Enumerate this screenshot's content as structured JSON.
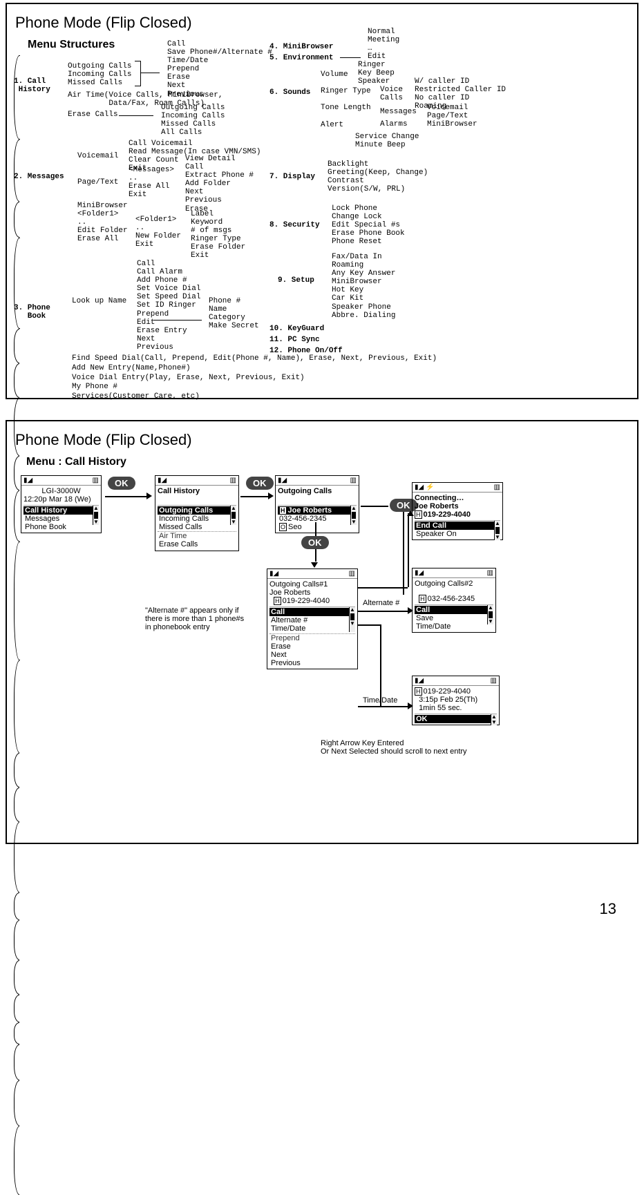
{
  "page_number": "13",
  "panel1": {
    "title": "Phone Mode (Flip Closed)",
    "section": "Menu Structures",
    "m1": {
      "label": "1. Call\n History",
      "outgoing": "Outgoing Calls",
      "incoming": "Incoming Calls",
      "missed": "Missed Calls",
      "airtime": "Air Time(Voice Calls, MiniBrowser,\n         Data/Fax, Roam Calls)",
      "erase": "Erase Calls",
      "sub_calls": "Call\nSave Phone#/Alternate #\nTime/Date\nPrepend\nErase\nNext\nPrevious",
      "erase_sub": "Outgoing Calls\nIncoming Calls\nMissed Calls\nAll Calls"
    },
    "m2": {
      "label": "2. Messages",
      "voicemail": "Voicemail",
      "voicemail_sub": "Call Voicemail\nRead Message(In case VMN/SMS)\nClear Count\nExit",
      "pagetext": "Page/Text",
      "pagetext_sub": "<Messages>\n..\nErase All\nExit",
      "pagetext_sub2": "View Detail\nCall\nExtract Phone #\nAdd Folder\nNext\nPrevious\nErase",
      "mini_folder": "MiniBrowser\n<Folder1>\n..\nEdit Folder\nErase All",
      "editfolder_sub1": "<Folder1>\n..\nNew Folder\nExit",
      "editfolder_sub2": "Label\nKeyword\n# of msgs\nRinger Type\nErase Folder\nExit"
    },
    "m3": {
      "label": "3. Phone\n   Book",
      "lookup": "Look up Name",
      "lookup_sub": "Call\nCall Alarm\nAdd Phone #\nSet Voice Dial\nSet Speed Dial\nSet ID Ringer\nPrepend\nEdit\nErase Entry\nNext\nPrevious",
      "edit_sub": "Phone #\nName\nCategory\nMake Secret",
      "rest": "Find Speed Dial(Call, Prepend, Edit(Phone #, Name), Erase, Next, Previous, Exit)\nAdd New Entry(Name,Phone#)\nVoice Dial Entry(Play, Erase, Next, Previous, Exit)\nMy Phone #\nServices(Customer Care, etc)"
    },
    "m4": {
      "label": "4. MiniBrowser"
    },
    "m5": {
      "label": "5. Environment",
      "sub": "Normal\nMeeting\n…\nEdit"
    },
    "m6": {
      "label": "6. Sounds",
      "sub1": "Ringer\nKey Beep\nSpeaker",
      "sub_main": "Volume\n\nRinger Type\n\nTone Length\n\nAlert",
      "ringer_voice": "Voice\nCalls",
      "ringer_voice_sub": "W/ caller ID\nRestricted Caller ID\nNo caller ID\nRoaming",
      "ringer_msgs": "Messages",
      "ringer_msgs_sub": "Voicemail\nPage/Text\nMiniBrowser",
      "ringer_alarms": "Alarms",
      "alert_sub": "Service Change\nMinute Beep"
    },
    "m7": {
      "label": "7. Display",
      "sub": "Backlight\nGreeting(Keep, Change)\nContrast\nVersion(S/W, PRL)"
    },
    "m8": {
      "label": "8. Security",
      "sub": "Lock Phone\nChange Lock\nEdit Special #s\nErase Phone Book\nPhone Reset"
    },
    "m9": {
      "label": "9. Setup",
      "sub": "Fax/Data In\nRoaming\nAny Key Answer\nMiniBrowser\nHot Key\nCar Kit\nSpeaker Phone\nAbbre. Dialing"
    },
    "m10": {
      "label": "10. KeyGuard"
    },
    "m11": {
      "label": "11. PC Sync"
    },
    "m12": {
      "label": "12. Phone On/Off"
    }
  },
  "panel2": {
    "title": "Phone Mode (Flip Closed)",
    "section": "Menu : Call History",
    "ok_label": "OK",
    "phone1": {
      "model": "LGI-3000W",
      "time": "12:20p Mar 18 (We)",
      "menu_sel": "Call History",
      "menu2": "Messages",
      "menu3": "Phone Book"
    },
    "phone2": {
      "title": "Call History",
      "sel": "Outgoing Calls",
      "r2": "Incoming Calls",
      "r3": "Missed Calls",
      "r4": "Air Time",
      "r5": "Erase Calls"
    },
    "phone3": {
      "title": "Outgoing Calls",
      "tag1": "H",
      "name1": "Joe Roberts",
      "num1": "032-456-2345",
      "tag2": "O",
      "name2": "Seo"
    },
    "phone4": {
      "title1": "Connecting…",
      "title2": "Joe Roberts",
      "tag": "H",
      "num": "019-229-4040",
      "sel": "End Call",
      "r2": "Speaker On"
    },
    "phone5": {
      "title": "Outgoing Calls#1",
      "name": "Joe Roberts",
      "tag": "H",
      "num": "019-229-4040",
      "sel": "Call",
      "r2": "Alternate #",
      "r3": "Time/Date",
      "r4": "Prepend",
      "r5": "Erase",
      "r6": "Next",
      "r7": "Previous"
    },
    "phone6": {
      "title": "Outgoing Calls#2",
      "tag": "H",
      "num": "032-456-2345",
      "sel": "Call",
      "r2": "Save",
      "r3": "Time/Date"
    },
    "phone7": {
      "tag": "H",
      "num": "019-229-4040",
      "time1": "3:15p Feb 25(Th)",
      "time2": "1min 55 sec.",
      "sel": "OK"
    },
    "labels": {
      "alternate_hash": "Alternate #",
      "time_date": "Time/Date",
      "alt_note": "\"Alternate #\" appears only if\nthere is more than 1 phone#s\nin phonebook entry",
      "scroll_note": "Right Arrow Key Entered\nOr Next Selected should scroll to next entry"
    },
    "icons": {
      "signal": "▮◢",
      "battery": "▮▮▮",
      "speaker": "🔊"
    }
  }
}
